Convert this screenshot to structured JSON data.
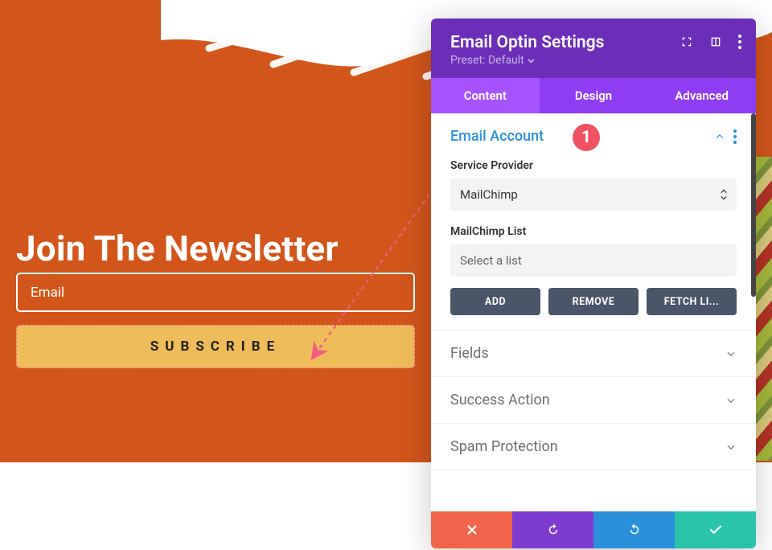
{
  "hero": {
    "title": "Join The Newsletter",
    "email_placeholder": "Email",
    "subscribe_label": "SUBSCRIBE"
  },
  "panel": {
    "title": "Email Optin Settings",
    "preset_label": "Preset: Default",
    "tabs": {
      "content": "Content",
      "design": "Design",
      "advanced": "Advanced"
    },
    "sections": {
      "email_account": {
        "title": "Email Account",
        "service_label": "Service Provider",
        "service_value": "MailChimp",
        "list_label": "MailChimp List",
        "list_value": "Select a list",
        "buttons": {
          "add": "ADD",
          "remove": "REMOVE",
          "fetch": "FETCH LI..."
        }
      },
      "fields": "Fields",
      "success_action": "Success Action",
      "spam_protection": "Spam Protection"
    }
  },
  "callout": {
    "number": "1"
  }
}
